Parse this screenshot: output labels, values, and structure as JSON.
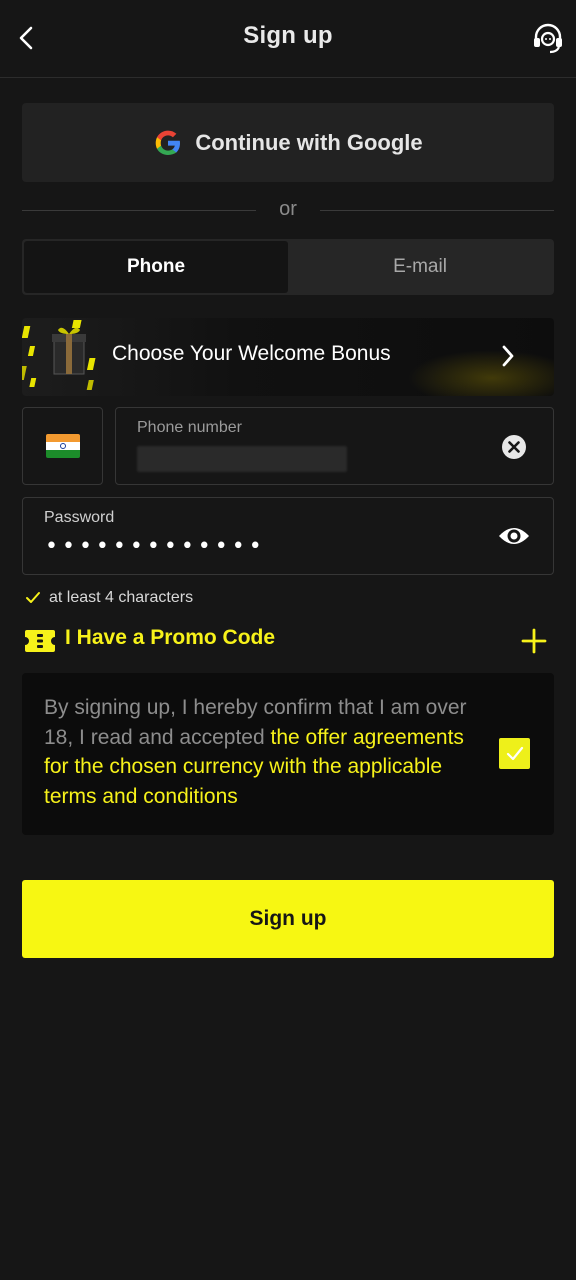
{
  "header": {
    "title": "Sign up"
  },
  "google_button": {
    "label": "Continue with Google"
  },
  "divider": {
    "text": "or"
  },
  "tabs": [
    {
      "label": "Phone",
      "active": true
    },
    {
      "label": "E-mail",
      "active": false
    }
  ],
  "bonus_banner": {
    "label": "Choose Your Welcome Bonus"
  },
  "phone_field": {
    "label": "Phone number",
    "country": "India"
  },
  "password_field": {
    "label": "Password",
    "value": "•••••••••••••"
  },
  "password_hint": {
    "text": "at least 4 characters"
  },
  "promo": {
    "label": "I Have a Promo Code"
  },
  "terms": {
    "text": "By signing up, I hereby confirm that I am over 18, I read and accepted ",
    "link_text": "the offer agreements for the chosen currency with the applicable terms and conditions",
    "checked": true
  },
  "signup_button": {
    "label": "Sign up"
  },
  "colors": {
    "accent": "#f7f712",
    "background": "#161616",
    "panel": "#222222"
  }
}
